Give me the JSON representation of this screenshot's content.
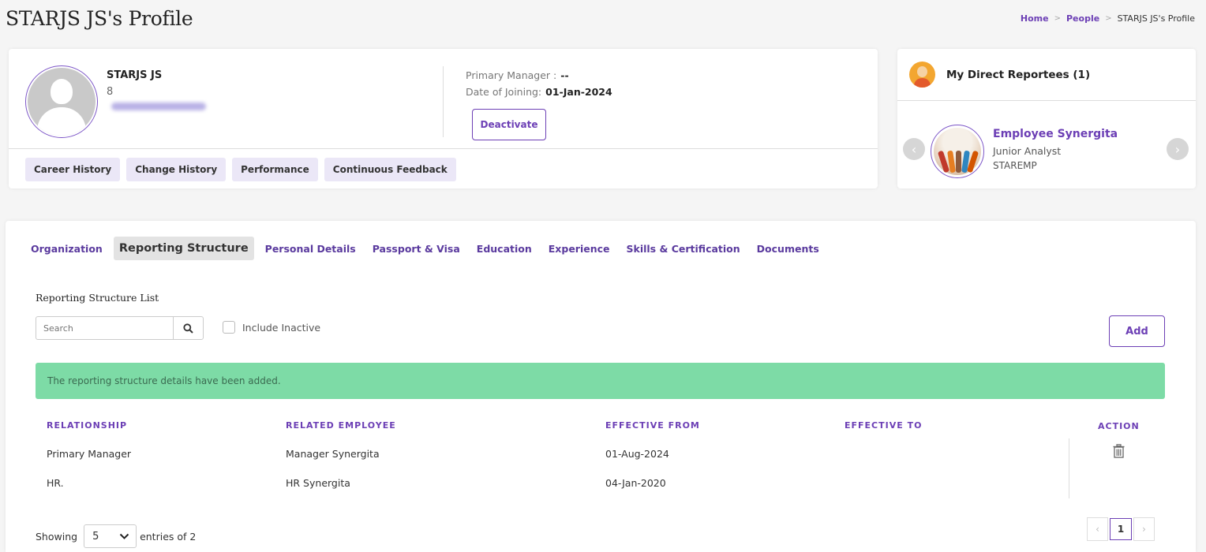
{
  "page": {
    "title": "STARJS JS's Profile"
  },
  "breadcrumb": {
    "items": [
      "Home",
      "People",
      "STARJS JS's Profile"
    ]
  },
  "profile": {
    "name": "STARJS JS",
    "code": "8",
    "primary_manager_label": "Primary Manager :",
    "primary_manager_value": "--",
    "joining_label": "Date of Joining:",
    "joining_value": "01-Jan-2024",
    "deactivate_label": "Deactivate",
    "quick_tabs": [
      "Career History",
      "Change History",
      "Performance",
      "Continuous Feedback"
    ]
  },
  "reportees": {
    "title": "My Direct Reportees (1)",
    "prev_icon": "chevron-left-icon",
    "next_icon": "chevron-right-icon",
    "employee": {
      "name": "Employee Synergita",
      "role": "Junior Analyst",
      "org": "STAREMP"
    }
  },
  "tabs": {
    "items": [
      "Organization",
      "Reporting Structure",
      "Personal Details",
      "Passport & Visa",
      "Education",
      "Experience",
      "Skills & Certification",
      "Documents"
    ],
    "active": "Reporting Structure"
  },
  "reporting": {
    "section_title": "Reporting Structure List",
    "search_placeholder": "Search",
    "include_inactive_label": "Include Inactive",
    "include_inactive_checked": false,
    "add_label": "Add",
    "alert_message": "The reporting structure details have been added.",
    "alert_color": "#7ddba6",
    "columns": {
      "relationship": "RELATIONSHIP",
      "related_employee": "RELATED EMPLOYEE",
      "effective_from": "EFFECTIVE FROM",
      "effective_to": "EFFECTIVE TO",
      "action": "ACTION"
    },
    "rows": [
      {
        "relationship": "Primary Manager",
        "related_employee": "Manager Synergita",
        "effective_from": "01-Aug-2024",
        "effective_to": "",
        "action_icon": "trash-icon"
      },
      {
        "relationship": "HR.",
        "related_employee": "HR Synergita",
        "effective_from": "04-Jan-2020",
        "effective_to": ""
      }
    ],
    "footer": {
      "showing_label": "Showing",
      "page_size": "5",
      "entries_label": "entries of 2",
      "current_page": "1"
    }
  },
  "colors": {
    "accent": "#6c3fb5",
    "tab_bg": "#ebe7f7",
    "alert_bg": "#7ddba6"
  }
}
